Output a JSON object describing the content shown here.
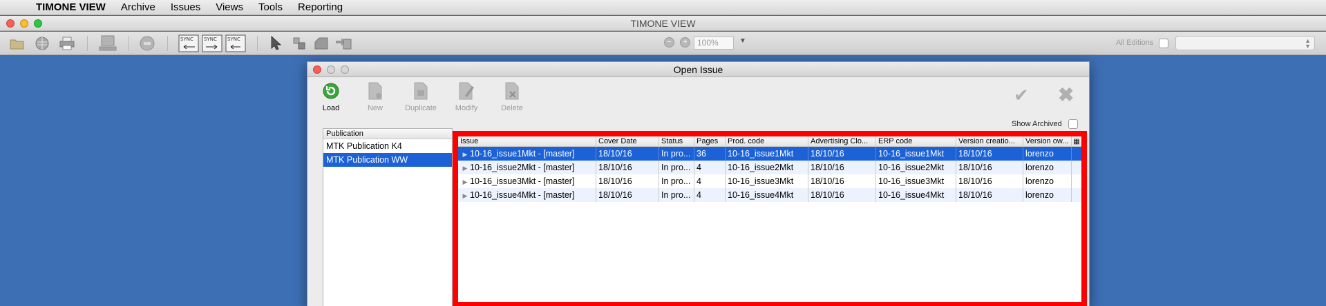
{
  "menubar": {
    "apple": "",
    "items": [
      "TIMONE VIEW",
      "Archive",
      "Issues",
      "Views",
      "Tools",
      "Reporting"
    ]
  },
  "window": {
    "title": "TIMONE VIEW"
  },
  "toolbar": {
    "zoom": "100%",
    "editions_label": "All Editions",
    "sync_label": "SYNC"
  },
  "dialog": {
    "title": "Open Issue",
    "buttons": [
      {
        "label": "Load",
        "icon": "load-icon",
        "enabled": true
      },
      {
        "label": "New",
        "icon": "new-doc-icon",
        "enabled": false
      },
      {
        "label": "Duplicate",
        "icon": "duplicate-icon",
        "enabled": false
      },
      {
        "label": "Modify",
        "icon": "modify-icon",
        "enabled": false
      },
      {
        "label": "Delete",
        "icon": "delete-icon",
        "enabled": false
      }
    ],
    "show_archived_label": "Show Archived",
    "publication": {
      "header": "Publication",
      "items": [
        "MTK Publication K4",
        "MTK Publication WW"
      ],
      "selected_index": 1
    },
    "issues": {
      "columns": [
        "Issue",
        "Cover Date",
        "Status",
        "Pages",
        "Prod. code",
        "Advertising Clo...",
        "ERP code",
        "Version creatio...",
        "Version ow..."
      ],
      "rows": [
        [
          "10-16_issue1Mkt - [master]",
          "18/10/16",
          "In pro...",
          "36",
          "10-16_issue1Mkt",
          "18/10/16",
          "10-16_issue1Mkt",
          "18/10/16",
          "lorenzo"
        ],
        [
          "10-16_issue2Mkt - [master]",
          "18/10/16",
          "In pro...",
          "4",
          "10-16_issue2Mkt",
          "18/10/16",
          "10-16_issue2Mkt",
          "18/10/16",
          "lorenzo"
        ],
        [
          "10-16_issue3Mkt - [master]",
          "18/10/16",
          "In pro...",
          "4",
          "10-16_issue3Mkt",
          "18/10/16",
          "10-16_issue3Mkt",
          "18/10/16",
          "lorenzo"
        ],
        [
          "10-16_issue4Mkt - [master]",
          "18/10/16",
          "In pro...",
          "4",
          "10-16_issue4Mkt",
          "18/10/16",
          "10-16_issue4Mkt",
          "18/10/16",
          "lorenzo"
        ]
      ],
      "selected_index": 0
    }
  },
  "colors": {
    "desktop": "#3d6fb5",
    "selection": "#1c62d6",
    "highlight_frame": "#ff0000"
  }
}
